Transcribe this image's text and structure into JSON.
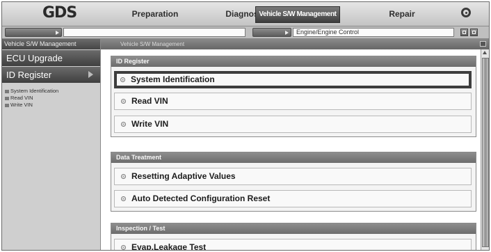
{
  "app": {
    "logo": "GDS"
  },
  "tabs": [
    {
      "label": "Preparation"
    },
    {
      "label": "Diagnosis"
    },
    {
      "label": "Vehicle S/W Management"
    },
    {
      "label": "Repair"
    }
  ],
  "path_bar": {
    "vehicle_value": "",
    "system_value": "Engine/Engine Control"
  },
  "sidebar": {
    "header": "Vehicle S/W Management",
    "items": [
      {
        "label": "ECU Upgrade"
      },
      {
        "label": "ID Register"
      }
    ],
    "sub_items": [
      {
        "label": "System Identification"
      },
      {
        "label": "Read VIN"
      },
      {
        "label": "Write VIN"
      }
    ]
  },
  "main": {
    "groups": [
      {
        "title": "ID Register",
        "rows": [
          {
            "label": "System Identification"
          },
          {
            "label": "Read VIN"
          },
          {
            "label": "Write VIN"
          }
        ]
      },
      {
        "title": "Data Treatment",
        "rows": [
          {
            "label": "Resetting Adaptive Values"
          },
          {
            "label": "Auto Detected Configuration Reset"
          }
        ]
      },
      {
        "title": "Inspection / Test",
        "rows": [
          {
            "label": "Evap.Leakage Test"
          }
        ]
      }
    ]
  },
  "colors": {
    "selected_border": "#3e3e3e",
    "active_tab": "#4a4a4a"
  },
  "icons": {
    "home": "home-icon",
    "row_bullet": "radio-icon",
    "sidebar_arrow": "chevron-right-icon"
  }
}
